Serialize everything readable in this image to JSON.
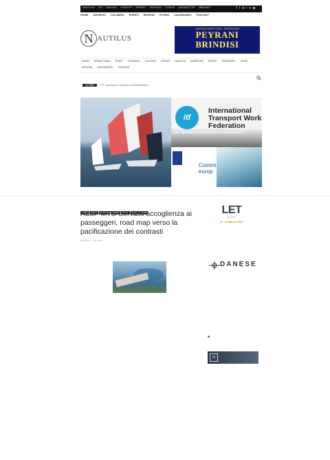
{
  "topbar": {
    "links": [
      "NAUTILUS",
      "CHI",
      "ITALIANO",
      "CONTATTI",
      "PRIVACY",
      "ARCHIVIO",
      "COOKIE",
      "NEWSLETTER",
      "ABBONATI"
    ],
    "social_icons": [
      "facebook-icon",
      "twitter-icon",
      "instagram-icon",
      "linkedin-icon",
      "youtube-icon"
    ]
  },
  "nav_primary": [
    "HOME",
    "ARCHIVIO",
    "CALABRIA",
    "EVENTI",
    "REGIONI",
    "STORIA",
    "CALENDARIO",
    "PODCAST"
  ],
  "logo": {
    "mark": "N",
    "wordmark": "AUTILUS",
    "tagline": ""
  },
  "ad": {
    "top": "AGENZIA MARITTIMA · SPEDIZIONI",
    "name": "PEYRANI BRINDISI",
    "text": ""
  },
  "nav_secondary_rows": [
    [
      "NEWS",
      "PRIMO PIANO",
      "PORTI",
      "CRONACA",
      "CULTURA",
      "EVENTI",
      "NAUTICA",
      "RUBRICHE",
      "SPORT",
      "TRASPORTI",
      "VIDEO"
    ],
    [
      "REGIONI",
      "CALENDARIO",
      "PODCAST"
    ]
  ],
  "ticker": {
    "badge": "ULTIME",
    "text": "ITF: ripristinare il trasporto nel Mediterraneo"
  },
  "hero": {
    "itf_logo": "itf",
    "itf_heading": [
      "International",
      "Transport Work",
      "Federation"
    ],
    "itf_caption": "ITF: ripristinare il trasporto nel Mediterraneo",
    "comm_text": [
      "Commi",
      "europ"
    ]
  },
  "article": {
    "categories": [
      "NEWS",
      "PORTI",
      "BRINDISI",
      "PUGLIA",
      "ITALIA",
      "PORTI",
      "ITALIA"
    ],
    "title": "AdSP MTS-Servizio accoglienza ai passeggeri, road map verso la pacificazione dei contrasti",
    "meta": "Redazione · 5 Mar 2023",
    "para1": "",
    "para2": "",
    "para3": ""
  },
  "sidebar": {
    "let": {
      "big": "LET",
      "sub": "EXPO",
      "date": "8 - 11 Marzo 2023",
      "desc": ""
    },
    "danese": {
      "name": "DANESE",
      "sub": ""
    },
    "banner": {
      "mark": "N",
      "text": ""
    }
  }
}
